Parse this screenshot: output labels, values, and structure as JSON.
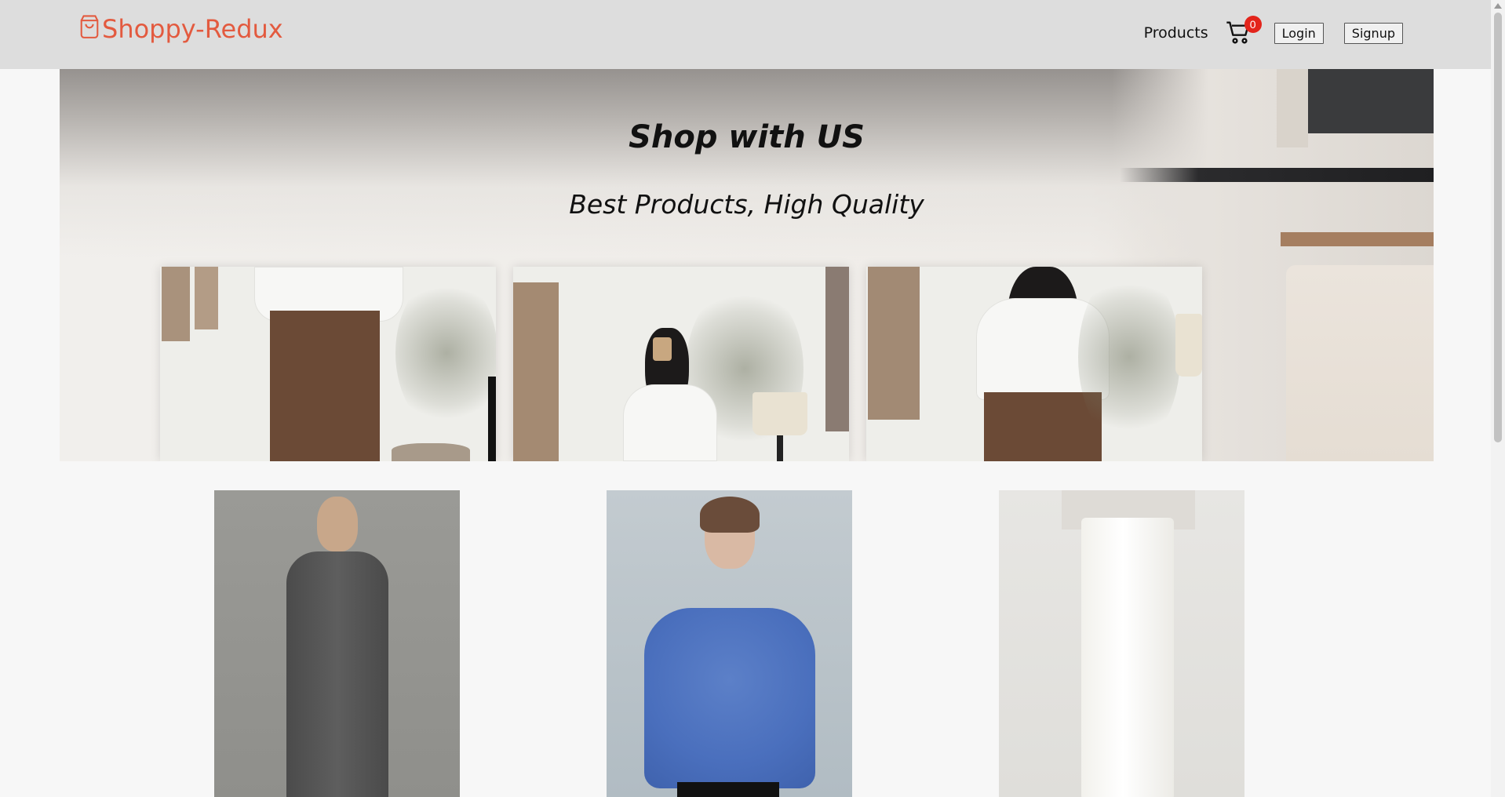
{
  "brand": {
    "name": "Shoppy-Redux",
    "icon": "shopping-bag-icon",
    "color": "#e35a3f"
  },
  "nav": {
    "products_label": "Products",
    "cart_icon": "cart-icon",
    "cart_count": "0",
    "login_label": "Login",
    "signup_label": "Signup"
  },
  "hero": {
    "title": "Shop with US",
    "subtitle": "Best Products, High Quality"
  },
  "products": [
    {
      "image": "grey-wool-coat-photo"
    },
    {
      "image": "blue-knit-cardigan-photo"
    },
    {
      "image": "white-denim-pants-photo"
    }
  ],
  "colors": {
    "navbar_bg": "#dddddd",
    "page_bg": "#f7f7f7",
    "badge": "#e3241b"
  }
}
